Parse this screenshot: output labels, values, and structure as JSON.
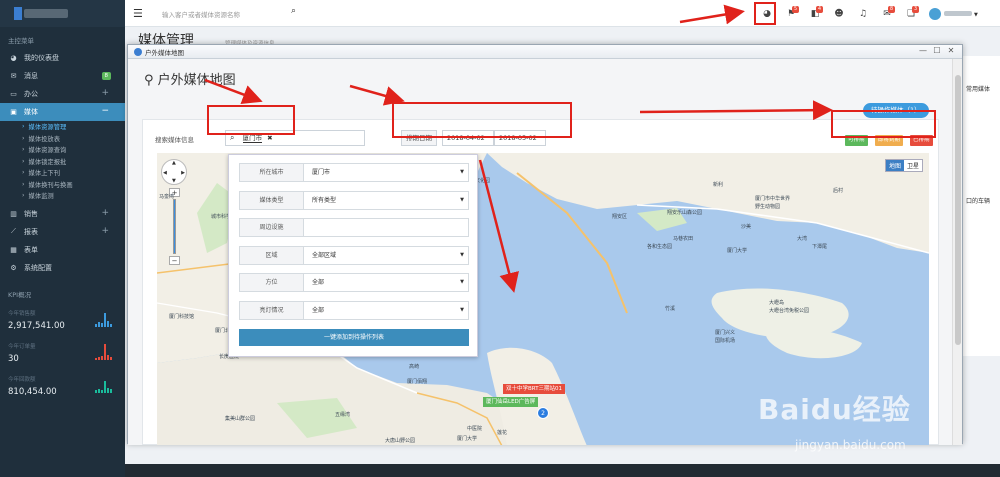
{
  "sidebar": {
    "menu_head": "主控菜单",
    "items": [
      {
        "label": "我的仪表盘",
        "icon": "dashboard-icon"
      },
      {
        "label": "消息",
        "icon": "mail-icon",
        "badge": "8"
      },
      {
        "label": "办公",
        "icon": "monitor-icon"
      },
      {
        "label": "媒体",
        "icon": "image-icon"
      }
    ],
    "sub_items": [
      "媒体资源管理",
      "媒体投放表",
      "媒体资源查询",
      "媒体锁定报批",
      "媒体上下刊",
      "媒体换刊与换画",
      "媒体监测"
    ],
    "items2": [
      {
        "label": "销售",
        "icon": "chart-icon"
      },
      {
        "label": "报表",
        "icon": "line-chart-icon"
      },
      {
        "label": "表单",
        "icon": "table-icon"
      },
      {
        "label": "系统配置",
        "icon": "gear-icon"
      }
    ],
    "kpi_title": "KPI概况",
    "kpis": [
      {
        "label": "今年销售额",
        "value": "2,917,541.00",
        "color": "#3c9bde"
      },
      {
        "label": "今年订单量",
        "value": "30",
        "color": "#e74c3c"
      },
      {
        "label": "今年回款额",
        "value": "810,454.00",
        "color": "#1abc9c"
      }
    ]
  },
  "topbar": {
    "search_placeholder": "输入客户或者媒体资源名称",
    "badges": [
      "5",
      "4",
      "8",
      "3"
    ]
  },
  "page": {
    "title": "媒体管理",
    "subtitle": "管理媒体及资源信息",
    "right_text1": "常用媒体",
    "right_text2": "口的车辆"
  },
  "modal": {
    "window_title": "户外媒体地图",
    "title": "户外媒体地图",
    "queue_button": "待操作媒体（1）",
    "search_label": "搜索媒体信息",
    "city_tag": "厦门市",
    "schedule_label": "排期日期",
    "date_start": "2018-04-02",
    "date_end": "2018-05-02",
    "status_tags": [
      {
        "label": "可排期",
        "color": "#5cb85c"
      },
      {
        "label": "即将到期",
        "color": "#f0ad4e"
      },
      {
        "label": "已排期",
        "color": "#e74c3c"
      }
    ],
    "map_type": [
      "地图",
      "卫星"
    ],
    "form": {
      "rows": [
        {
          "label": "所在城市",
          "value": "厦门市",
          "select": true
        },
        {
          "label": "媒体类型",
          "value": "所有类型",
          "select": true
        },
        {
          "label": "周边设施",
          "value": "",
          "select": false
        },
        {
          "label": "区域",
          "value": "全部区域",
          "select": true
        },
        {
          "label": "方位",
          "value": "全部",
          "select": true
        },
        {
          "label": "亮灯情况",
          "value": "全部",
          "select": true
        }
      ],
      "add_button": "一键添加到待操作列表"
    },
    "map_labels": [
      "马銮湾",
      "新阳",
      "大青",
      "古龙酱文化园",
      "翔安区",
      "翔安乐山森公园",
      "厦门市中华世界",
      "野生动物园",
      "城市科学公园",
      "后村",
      "新利",
      "下潭尾",
      "沙美",
      "马巷农田",
      "各和生态园",
      "厦门大学",
      "大湾",
      "杏林湾",
      "厦门北站",
      "厦门科技馆",
      "竹溪",
      "大嶝岛",
      "大嶝台湾免税公园",
      "厦门兴义",
      "国际机场",
      "长庚医院",
      "高崎",
      "厦门佰翔",
      "集美山群公园",
      "五缘湾",
      "莲花",
      "大唐山野公园",
      "厦门大学",
      "中医院"
    ],
    "pins": [
      {
        "label": "双十中学BRT三期站01",
        "color": "#e74c3c"
      },
      {
        "label": "厦门仙岳LED广告屏",
        "color": "#5cb85c"
      }
    ],
    "cluster_count": "2"
  },
  "watermark": {
    "main": "Baidu经验",
    "sub": "jingyan.baidu.com"
  }
}
